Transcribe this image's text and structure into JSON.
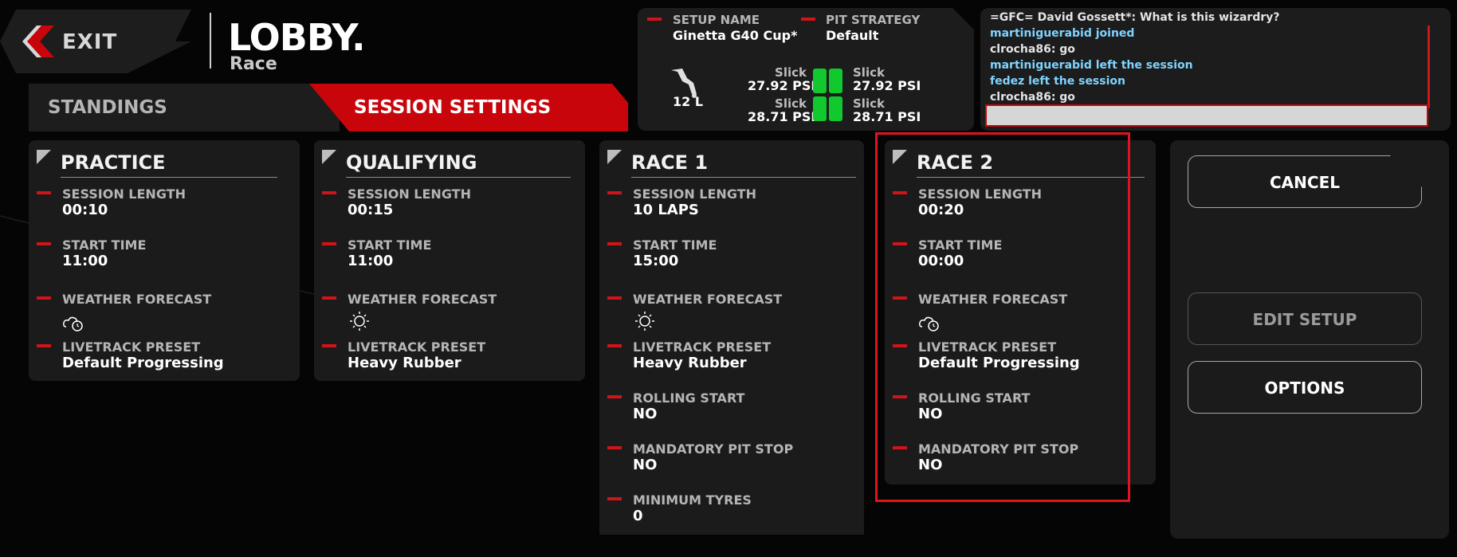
{
  "header": {
    "exit_label": "EXIT",
    "title": "LOBBY.",
    "subtitle": "Race"
  },
  "tabs": [
    {
      "label": "STANDINGS",
      "active": false
    },
    {
      "label": "SESSION SETTINGS",
      "active": true
    }
  ],
  "setup": {
    "setup_name_label": "SETUP NAME",
    "setup_name": "Ginetta G40 Cup*",
    "pit_strategy_label": "PIT STRATEGY",
    "pit_strategy": "Default",
    "fuel": "12 L",
    "tyres": {
      "fl_compound": "Slick",
      "fl_psi": "27.92 PSI",
      "fr_compound": "Slick",
      "fr_psi": "27.92 PSI",
      "rl_compound": "Slick",
      "rl_psi": "28.71 PSI",
      "rr_compound": "Slick",
      "rr_psi": "28.71 PSI"
    }
  },
  "chat": {
    "messages": [
      {
        "text": "=GFC= David Gossett*: What is this wizardry?",
        "kind": "user"
      },
      {
        "text": "martiniguerabid joined",
        "kind": "sys"
      },
      {
        "text": "clrocha86: go",
        "kind": "user"
      },
      {
        "text": "martiniguerabid left the session",
        "kind": "sys"
      },
      {
        "text": "fedez left the session",
        "kind": "sys"
      },
      {
        "text": "clrocha86: go",
        "kind": "user"
      }
    ],
    "input_value": ""
  },
  "labels": {
    "session_length": "SESSION LENGTH",
    "start_time": "START TIME",
    "weather_forecast": "WEATHER FORECAST",
    "livetrack_preset": "LIVETRACK PRESET",
    "rolling_start": "ROLLING START",
    "mandatory_pit_stop": "MANDATORY PIT STOP",
    "minimum_tyres": "MINIMUM TYRES"
  },
  "sessions": {
    "practice": {
      "title": "PRACTICE",
      "session_length": "00:10",
      "start_time": "11:00",
      "weather": "cloudy-night-icon",
      "livetrack": "Default Progressing"
    },
    "qualifying": {
      "title": "QUALIFYING",
      "session_length": "00:15",
      "start_time": "11:00",
      "weather": "sun-icon",
      "livetrack": "Heavy Rubber"
    },
    "race1": {
      "title": "RACE 1",
      "session_length": "10 LAPS",
      "start_time": "15:00",
      "weather": "sun-icon",
      "livetrack": "Heavy Rubber",
      "rolling_start": "NO",
      "mandatory_pit_stop": "NO",
      "minimum_tyres": "0"
    },
    "race2": {
      "title": "RACE 2",
      "session_length": "00:20",
      "start_time": "00:00",
      "weather": "cloudy-night-icon",
      "livetrack": "Default Progressing",
      "rolling_start": "NO",
      "mandatory_pit_stop": "NO"
    }
  },
  "buttons": {
    "cancel": "CANCEL",
    "edit_setup": "EDIT SETUP",
    "options": "OPTIONS"
  },
  "colors": {
    "accent_red": "#c8050b",
    "tyre_green": "#11c82e",
    "chat_system": "#7fd3ff"
  }
}
